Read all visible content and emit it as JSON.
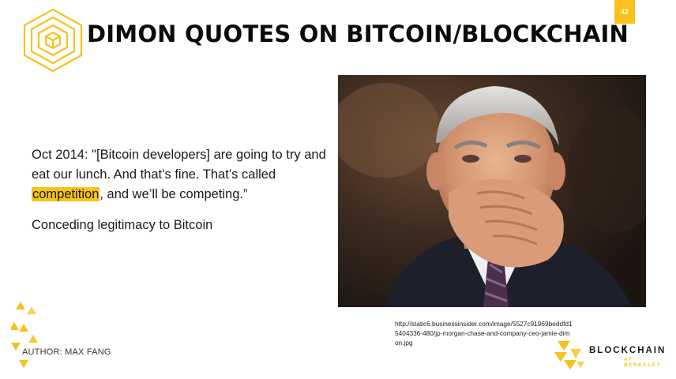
{
  "slide": {
    "page_number": "42",
    "title": "DIMON QUOTES ON BITCOIN/BLOCKCHAIN",
    "quote": {
      "part1": "Oct 2014: \"[Bitcoin developers] are going to try and eat our lunch. And that’s fine. That’s called ",
      "highlight": "competition",
      "part2": ", and we’ll be competing.”"
    },
    "subpoint": "Conceding legitimacy to Bitcoin",
    "image_source": "http://static6.businessinsider.com/image/5527c91969beddfd15404336-480/jp-morgan-chase-and-company-ceo-jamie-dimon.jpg",
    "author": "AUTHOR: MAX FANG",
    "brand": {
      "name": "BLOCKCHAIN",
      "sub": "AT BERKELEY"
    }
  },
  "colors": {
    "accent": "#f7c21a",
    "text": "#1a1a1a"
  },
  "icons": {
    "top_logo": "hexagon-cube-logo",
    "bottom_logo": "blockchain-berkeley-logo",
    "decoration": "triangle-pattern"
  }
}
